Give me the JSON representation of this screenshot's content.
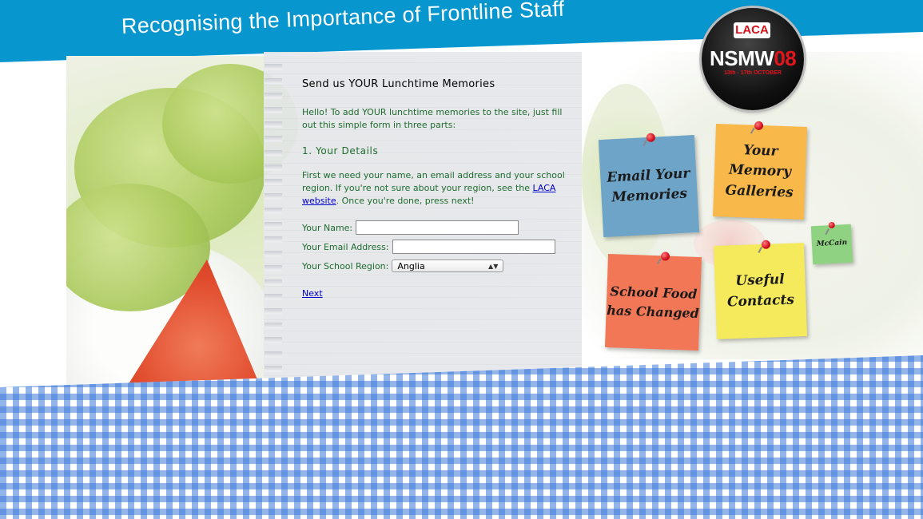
{
  "header": {
    "title": "Recognising the Importance of Frontline Staff"
  },
  "logo": {
    "laca": "LACA",
    "nsmw": "NSMW",
    "nsmw_year": "08",
    "dates": "13th - 17th OCTOBER"
  },
  "form": {
    "title": "Send us YOUR Lunchtime Memories",
    "intro": "Hello! To add YOUR lunchtime memories to the site, just fill out this simple form in three parts:",
    "section_title": "1. Your Details",
    "desc_part1": "First we need your name, an email address and your school region. If you're not sure about your region, see the",
    "desc_link": "LACA website",
    "desc_part2": ". Once you're done, press next!",
    "name_label": "Your Name:",
    "name_value": "",
    "email_label": "Your Email Address:",
    "email_value": "",
    "region_label": "Your School Region:",
    "region_selected": "Anglia",
    "next_label": "Next"
  },
  "notes": {
    "email": "Email Your Memories",
    "gallery": "Your Memory Galleries",
    "school_food": "School Food has Changed",
    "useful": "Useful Contacts",
    "mccain": "McCain"
  },
  "colors": {
    "banner": "#0896cf",
    "note_email": "#6ea4c7",
    "note_gallery": "#f9b84a",
    "note_school": "#f27757",
    "note_useful": "#f4ea5b",
    "note_mccain": "#8fd281",
    "link": "#0000cc",
    "form_text": "#1f6b2f"
  }
}
